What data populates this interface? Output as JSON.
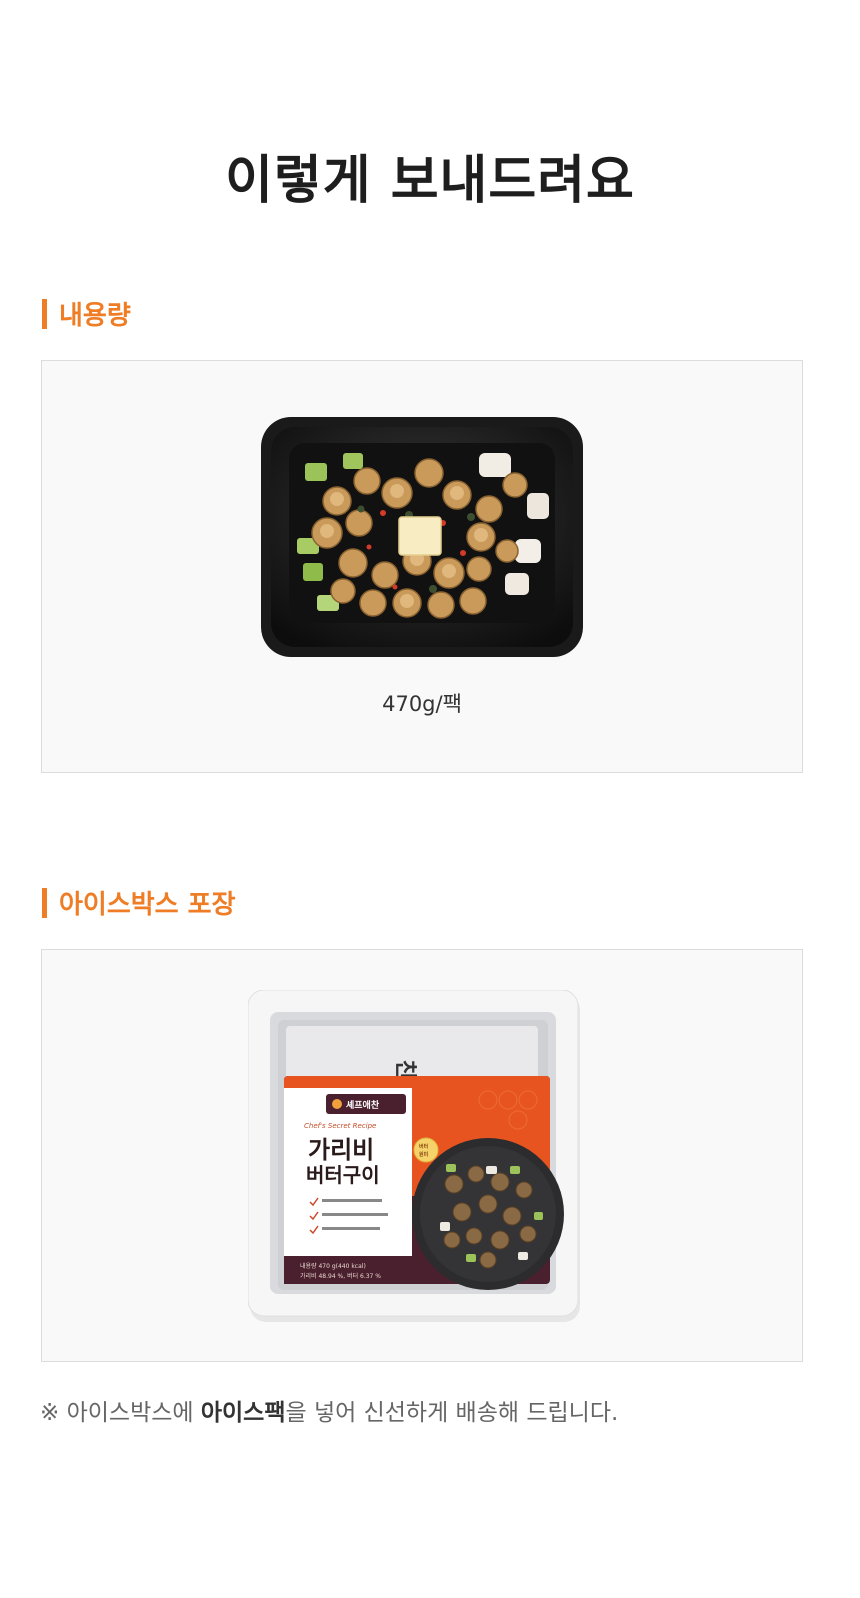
{
  "page": {
    "title": "이렇게 보내드려요"
  },
  "sections": [
    {
      "heading": "내용량",
      "caption": "470g/팩",
      "icon": "section-bar-icon"
    },
    {
      "heading": "아이스박스 포장",
      "icon": "section-bar-icon"
    }
  ],
  "package": {
    "brand": "셰프애찬",
    "subtitle": "Chef's Secret Recipe",
    "product_name_line1": "가리비",
    "product_name_line2": "버터구이",
    "badge": "버터\n원미",
    "nutrition_line1": "내용량 470 g(440 kcal)",
    "nutrition_line2": "가리비 48.94 %, 버터 6.37 %"
  },
  "note": {
    "prefix": "※ 아이스박스에 ",
    "bold": "아이스팩",
    "suffix": "을 넣어 신선하게 배송해 드립니다."
  },
  "colors": {
    "accent": "#ee7d26",
    "panel_bg": "#f9f9f9",
    "panel_border": "#dcdcdc",
    "package_orange": "#e8541f",
    "package_dark": "#4a1f2e"
  }
}
